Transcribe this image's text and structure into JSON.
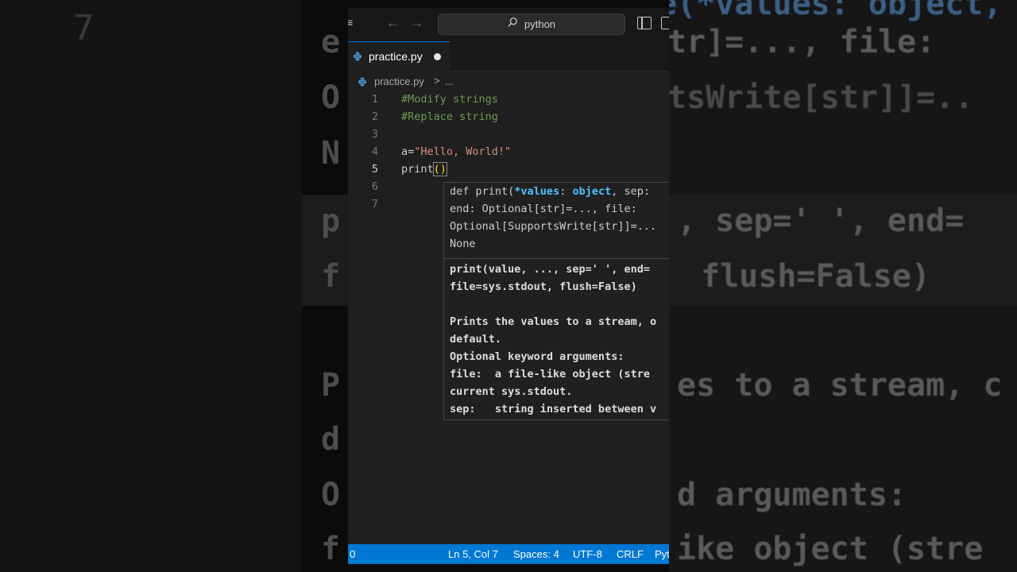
{
  "background": {
    "left_number": "7",
    "right_lines": [
      "e(*values: object, sep:",
      "tr]=..., file:",
      "tsWrite[str]]=..",
      ", sep=' ', end=",
      "flush=False)",
      "es to a stream, c",
      "d arguments:",
      "ike object (stre"
    ],
    "left_ghosts": [
      "e",
      "O",
      "N",
      "p",
      "f",
      "P",
      "d",
      "O",
      "f"
    ]
  },
  "titlebar": {
    "search_text": "python"
  },
  "tab": {
    "label": "practice.py"
  },
  "breadcrumb": {
    "file": "practice.py",
    "separator": ">",
    "more": "..."
  },
  "editor": {
    "lines": [
      {
        "num": "1",
        "text": "#Modify strings"
      },
      {
        "num": "2",
        "text": "#Replace string"
      },
      {
        "num": "3",
        "text": ""
      },
      {
        "num": "4",
        "var": "a=",
        "string": "\"Hello, World!\""
      },
      {
        "num": "5",
        "fn": "print",
        "paren": "()"
      },
      {
        "num": "6",
        "text": ""
      },
      {
        "num": "7",
        "text": ""
      }
    ],
    "active_line": "5"
  },
  "popup": {
    "signature": {
      "def_kw": "def",
      "fn_name": " print(",
      "param": "*values",
      "colon": ": ",
      "type": "object",
      "rest1": ", sep:",
      "line2": "end: Optional[str]=..., file:",
      "line3": "Optional[SupportsWrite[str]]=...",
      "line4": "None"
    },
    "doc_lines": [
      "print(value, ..., sep=' ', end=",
      "file=sys.stdout, flush=False)",
      "",
      "Prints the values to a stream, o",
      "default.",
      "Optional keyword arguments:",
      "file:  a file-like object (stre",
      "current sys.stdout.",
      "sep:   string inserted between v"
    ]
  },
  "statusbar": {
    "left": "0",
    "position": "Ln 5, Col 7",
    "spaces": "Spaces: 4",
    "encoding": "UTF-8",
    "eol": "CRLF",
    "language": "Python"
  },
  "colors": {
    "accent": "#0078d4",
    "comment": "#6a9955",
    "string": "#ce9178",
    "function": "#dcdcaa"
  }
}
